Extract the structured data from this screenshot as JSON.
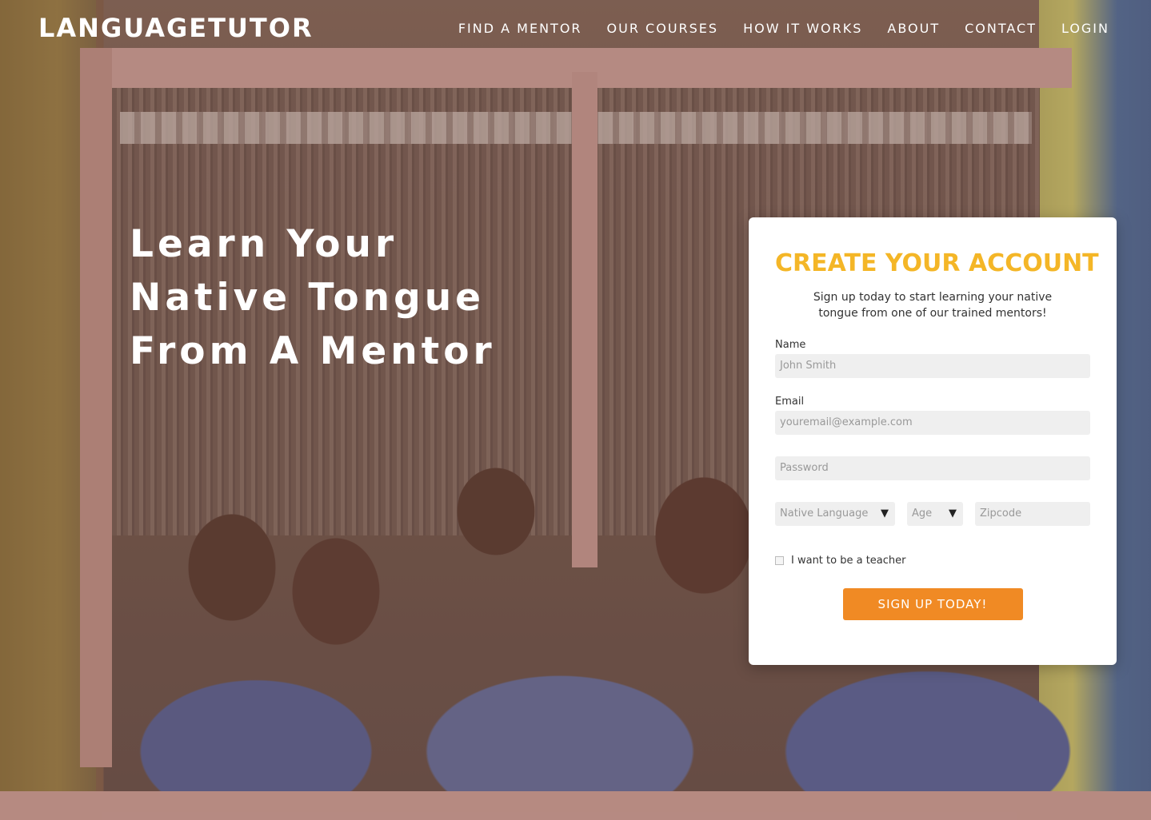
{
  "brand": {
    "logo": "LANGUAGETUTOR"
  },
  "nav": {
    "items": [
      "FIND A MENTOR",
      "OUR COURSES",
      "HOW IT WORKS",
      "ABOUT",
      "CONTACT",
      "LOGIN"
    ]
  },
  "hero": {
    "headline_lines": [
      "Learn Your",
      "Native Tongue",
      "From A Mentor"
    ]
  },
  "signup": {
    "title": "CREATE YOUR ACCOUNT",
    "subtitle": "Sign up today to start learning your native tongue from one of our trained mentors!",
    "name_label": "Name",
    "name_placeholder": "John Smith",
    "email_label": "Email",
    "email_placeholder": "youremail@example.com",
    "password_placeholder": "Password",
    "language_select": "Native Language",
    "age_select": "Age",
    "zip_placeholder": "Zipcode",
    "teacher_checkbox_label": "I want to be a teacher",
    "teacher_checked": false,
    "submit_label": "SIGN UP TODAY!"
  },
  "colors": {
    "title": "#f4b627",
    "button": "#f08a24",
    "input_bg": "#efefef"
  },
  "icons": {
    "dropdown": "dropdown-triangle-icon"
  }
}
